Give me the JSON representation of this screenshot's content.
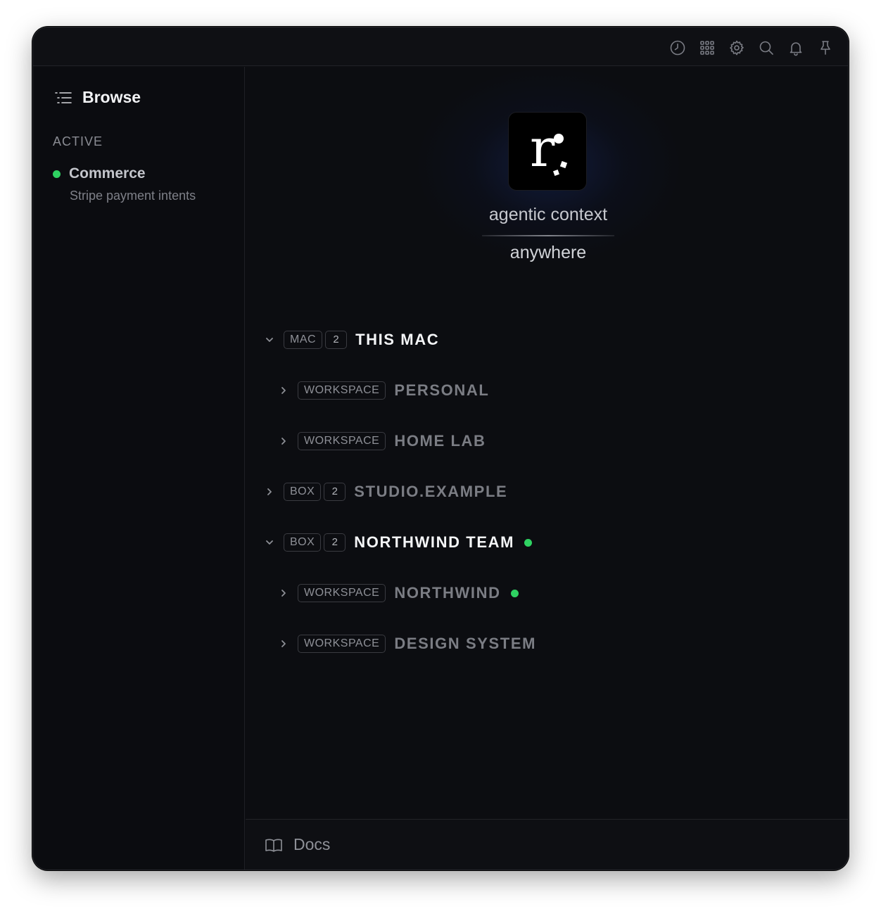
{
  "toolbar": {
    "icons": [
      "clock-icon",
      "grid-icon",
      "gear-icon",
      "search-icon",
      "bell-icon",
      "pin-icon"
    ]
  },
  "sidebar": {
    "title": "Browse",
    "section_label": "ACTIVE",
    "active_items": [
      {
        "name": "Commerce",
        "description": "Stripe payment intents",
        "status_color": "#2fd262"
      }
    ]
  },
  "hero": {
    "logo_letter": "r",
    "tagline_top": "agentic context",
    "tagline_bottom": "anywhere"
  },
  "tree": [
    {
      "expanded": true,
      "tag": "MAC",
      "count": "2",
      "name": "THIS MAC",
      "active": false,
      "bright": true
    },
    {
      "expanded": false,
      "tag": "WORKSPACE",
      "count": null,
      "name": "PERSONAL",
      "active": false,
      "bright": false
    },
    {
      "expanded": false,
      "tag": "WORKSPACE",
      "count": null,
      "name": "HOME LAB",
      "active": false,
      "bright": false
    },
    {
      "expanded": false,
      "tag": "BOX",
      "count": "2",
      "name": "STUDIO.EXAMPLE",
      "active": false,
      "bright": false
    },
    {
      "expanded": true,
      "tag": "BOX",
      "count": "2",
      "name": "NORTHWIND TEAM",
      "active": true,
      "bright": true
    },
    {
      "expanded": false,
      "tag": "WORKSPACE",
      "count": null,
      "name": "NORTHWIND",
      "active": true,
      "bright": false
    },
    {
      "expanded": false,
      "tag": "WORKSPACE",
      "count": null,
      "name": "DESIGN SYSTEM",
      "active": false,
      "bright": false
    }
  ],
  "footer": {
    "docs_label": "Docs"
  },
  "colors": {
    "accent_green": "#2fd262",
    "background": "#0c0d11"
  }
}
